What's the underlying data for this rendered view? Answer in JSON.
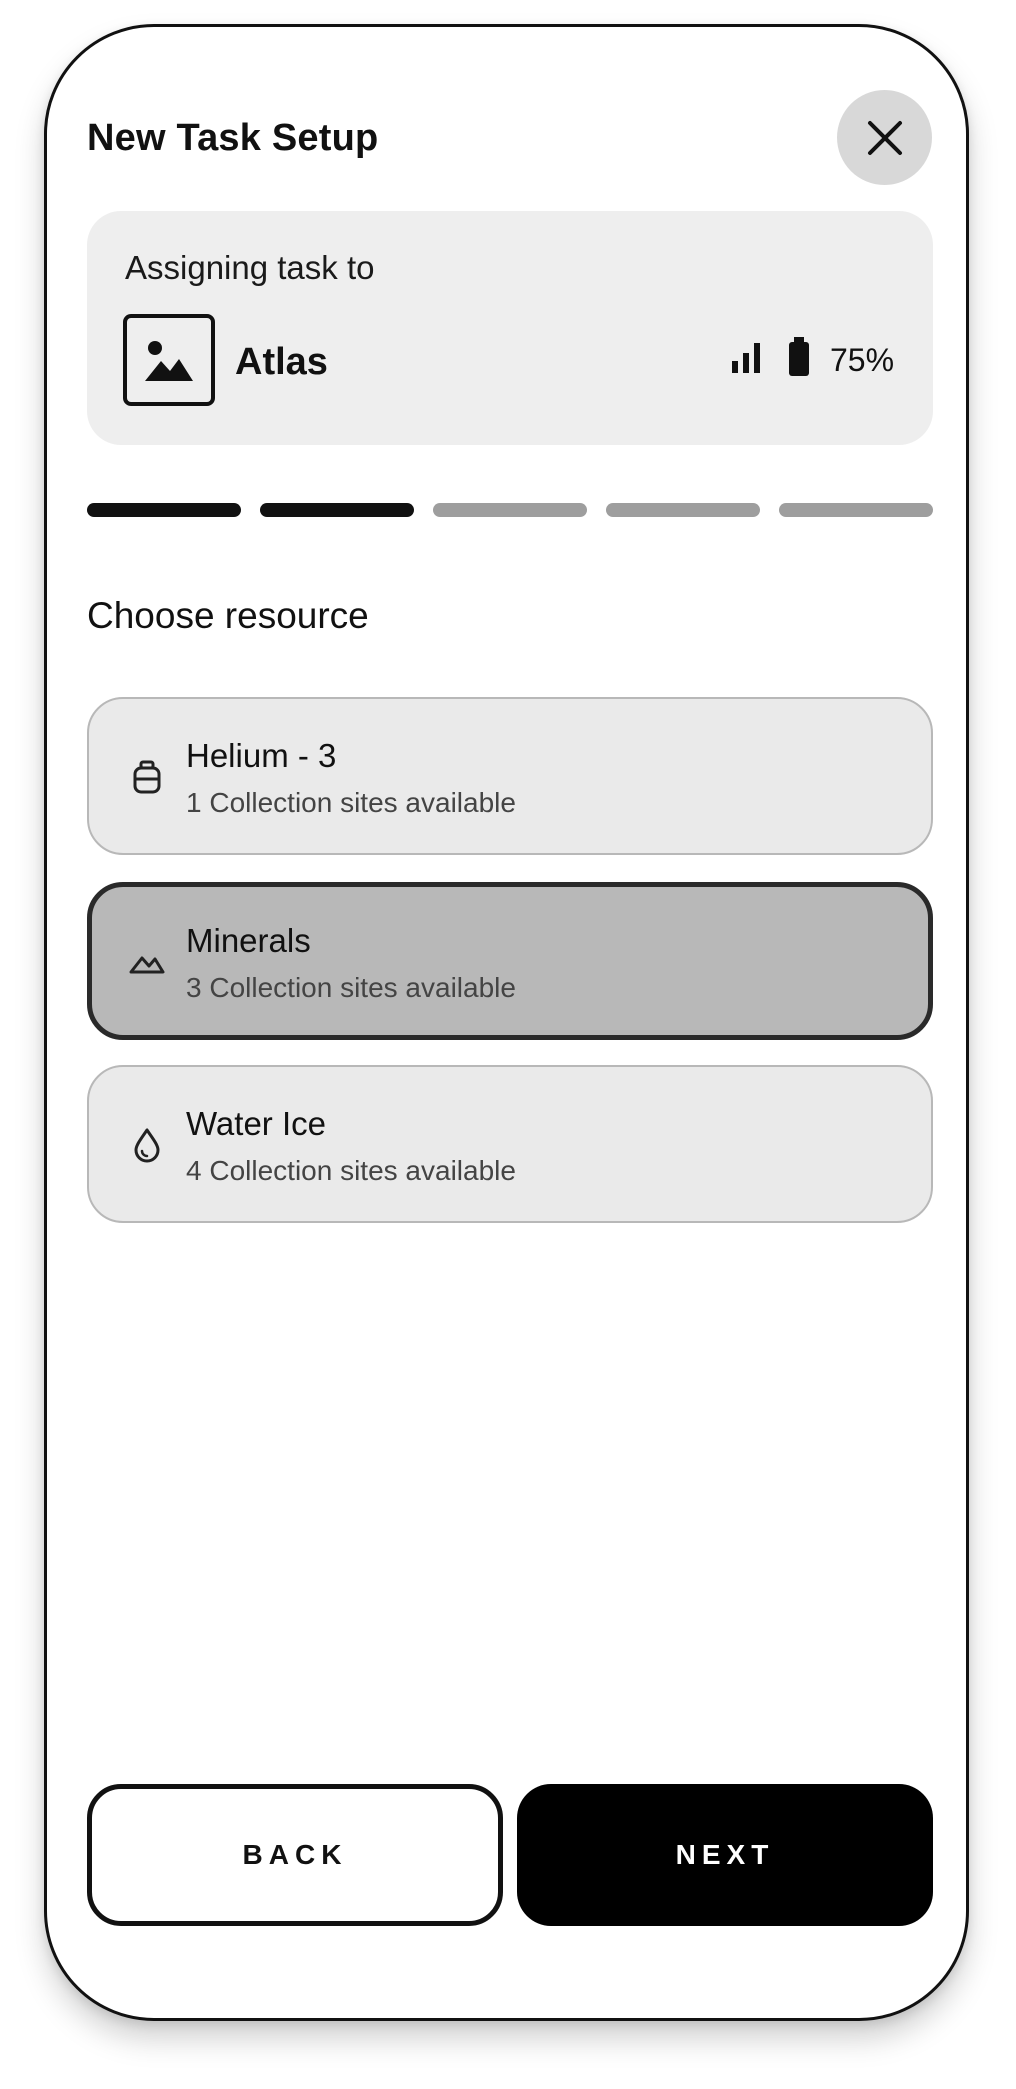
{
  "header": {
    "title": "New Task Setup",
    "close_icon": "close-icon"
  },
  "assignment": {
    "label": "Assigning task to",
    "avatar_icon": "image-placeholder-icon",
    "robot_name": "Atlas",
    "signal_icon": "signal-bars-icon",
    "battery_icon": "battery-icon",
    "battery_percent": "75%"
  },
  "progress": {
    "total_steps": 5,
    "completed_steps": 2
  },
  "resources": {
    "title": "Choose resource",
    "selected_index": 1,
    "items": [
      {
        "name": "Helium - 3",
        "subtitle": "1 Collection sites available",
        "icon": "gas-canister-icon"
      },
      {
        "name": "Minerals",
        "subtitle": "3 Collection sites available",
        "icon": "mountains-icon"
      },
      {
        "name": "Water Ice",
        "subtitle": "4 Collection sites available",
        "icon": "water-drop-icon"
      }
    ]
  },
  "footer": {
    "back_label": "BACK",
    "next_label": "NEXT"
  },
  "colors": {
    "primary": "#000000",
    "card_background": "#eeeeee",
    "selected_background": "#b8b8b8",
    "progress_inactive": "#9e9e9e"
  }
}
